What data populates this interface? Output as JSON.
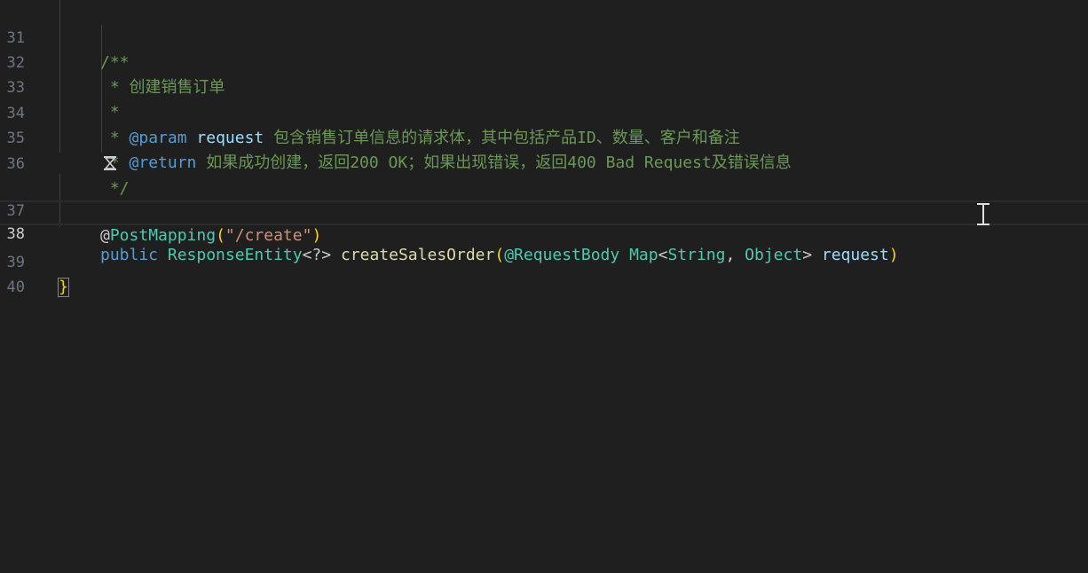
{
  "editor": {
    "lines": [
      {
        "num": "31"
      },
      {
        "num": "32"
      },
      {
        "num": "33"
      },
      {
        "num": "34"
      },
      {
        "num": "35"
      },
      {
        "num": "36"
      },
      {
        "num": "37"
      },
      {
        "num": "38"
      },
      {
        "num": "39"
      },
      {
        "num": "40"
      }
    ],
    "doc": {
      "open": "/**",
      "summary": " * 创建销售订单",
      "blank": " *",
      "param_prefix": " * ",
      "param_tag": "@param",
      "param_name": "request",
      "param_desc": " 包含销售订单信息的请求体，其中包括产品ID、数量、客户和备注",
      "return_prefix": " * ",
      "return_tag": "@return",
      "return_desc": " 如果成功创建，返回200 OK；如果出现错误，返回400 Bad Request及错误信息",
      "close": " */"
    },
    "annotation": {
      "at": "@",
      "name": "PostMapping",
      "open": "(",
      "value": "\"/create\"",
      "close": ")"
    },
    "signature": {
      "kw_public": "public",
      "return_type": "ResponseEntity",
      "generic": "<?>",
      "method": "createSalesOrder",
      "open": "(",
      "param_annotation": "@RequestBody",
      "param_type": "Map",
      "lt": "<",
      "t1": "String",
      "comma": ", ",
      "t2": "Object",
      "gt": ">",
      "param_name": "request",
      "close": ")"
    },
    "closing_brace": "}",
    "colors": {
      "background": "#1f1f1f",
      "comment": "#6a9955",
      "keyword": "#569cd6",
      "type": "#4ec9b0",
      "function": "#dcdcaa",
      "string": "#ce9178",
      "variable": "#9cdcfe"
    },
    "icons": {
      "codelens": "hourglass-icon",
      "cursor": "text-cursor-icon"
    }
  }
}
